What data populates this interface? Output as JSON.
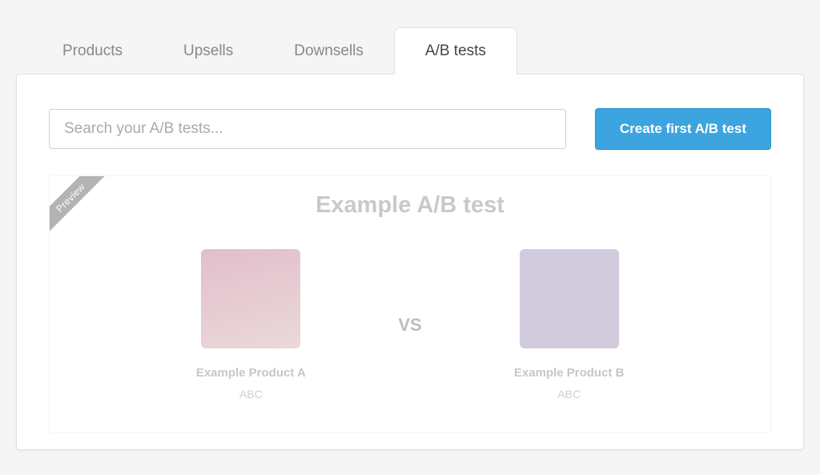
{
  "tabs": [
    {
      "label": "Products"
    },
    {
      "label": "Upsells"
    },
    {
      "label": "Downsells"
    },
    {
      "label": "A/B tests"
    }
  ],
  "search": {
    "placeholder": "Search your A/B tests..."
  },
  "create_button": "Create first A/B test",
  "card": {
    "ribbon": "Preview",
    "title": "Example A/B test",
    "vs_label": "VS",
    "product_a": {
      "name": "Example Product A",
      "code": "ABC"
    },
    "product_b": {
      "name": "Example Product B",
      "code": "ABC"
    }
  }
}
